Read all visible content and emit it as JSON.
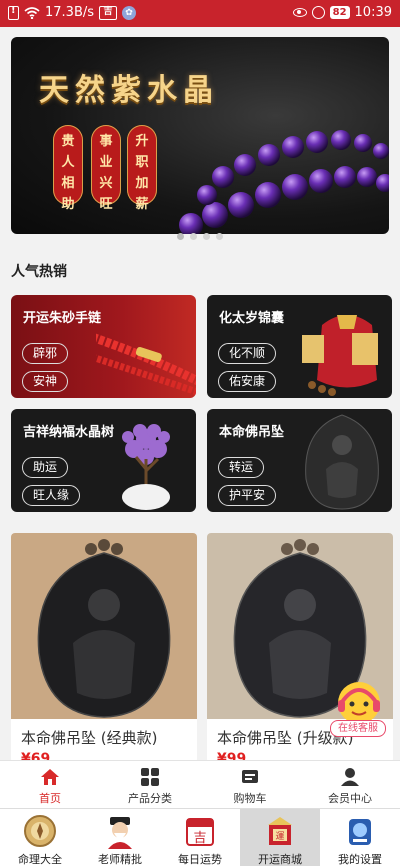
{
  "status_bar": {
    "speed": "17.3B/s",
    "app_badge": "",
    "battery": "82",
    "time": "10:39"
  },
  "banner": {
    "title": "天然紫水晶",
    "tags": [
      {
        "lines": [
          "贵",
          "人",
          "相",
          "助"
        ]
      },
      {
        "lines": [
          "事",
          "业",
          "兴",
          "旺"
        ]
      },
      {
        "lines": [
          "升",
          "职",
          "加",
          "薪"
        ]
      }
    ],
    "colors": {
      "title": "#f6d48a",
      "tag_bg": "#b81b1b",
      "bead": "#6a2fb5"
    }
  },
  "section": {
    "title": "人气热销"
  },
  "promos": [
    {
      "title": "开运朱砂手链",
      "tags": [
        "辟邪",
        "安神"
      ],
      "bg": "#8c1418"
    },
    {
      "title": "化太岁锦囊",
      "tags": [
        "化不顺",
        "佑安康"
      ],
      "bg": "#1a1a1a"
    },
    {
      "title": "吉祥纳福水晶树",
      "tags": [
        "助运",
        "旺人缘"
      ],
      "bg": "#1a1a1a"
    },
    {
      "title": "本命佛吊坠",
      "tags": [
        "转运",
        "护平安"
      ],
      "bg": "#1c1c1c"
    }
  ],
  "products": [
    {
      "name": "本命佛吊坠 (经典款)",
      "price": "¥69",
      "bg": "#c9a884"
    },
    {
      "name": "本命佛吊坠 (升级款)",
      "price": "¥99",
      "bg": "#cbbda9"
    }
  ],
  "chat": {
    "label": "在线客服"
  },
  "tabs": [
    {
      "label": "首页",
      "icon": "home-icon",
      "active": true
    },
    {
      "label": "产品分类",
      "icon": "grid-icon",
      "active": false
    },
    {
      "label": "购物车",
      "icon": "cart-icon",
      "active": false
    },
    {
      "label": "会员中心",
      "icon": "user-icon",
      "active": false
    }
  ],
  "bottom_nav": [
    {
      "label": "命理大全",
      "icon": "compass-icon",
      "active": false
    },
    {
      "label": "老师精批",
      "icon": "master-icon",
      "active": false
    },
    {
      "label": "每日运势",
      "icon": "calendar-icon",
      "active": false
    },
    {
      "label": "开运商城",
      "icon": "shop-icon",
      "active": true
    },
    {
      "label": "我的设置",
      "icon": "settings-icon",
      "active": false
    }
  ],
  "accent": "#c8232c"
}
